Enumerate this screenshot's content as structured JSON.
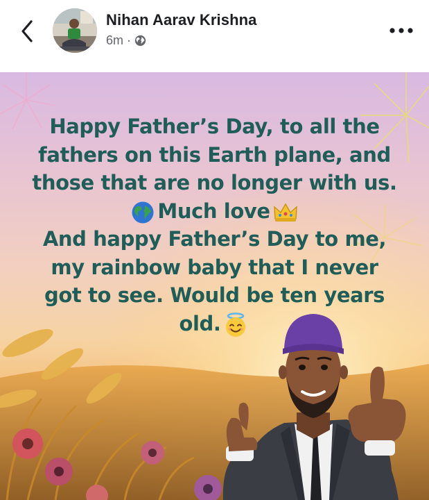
{
  "header": {
    "author_name": "Nihan Aarav Krishna",
    "timestamp": "6m",
    "separator": "·",
    "privacy_icon": "globe-icon",
    "back_icon": "chevron-left-icon",
    "more_icon": "more-horizontal-icon"
  },
  "post": {
    "lines": [
      "Happy Father’s Day, to all the",
      "fathers on this Earth plane, and",
      "those that are no longer with us.",
      "Much love",
      "And happy Father’s Day to me,",
      "my rainbow baby that I never",
      "got to see. Would be ten years",
      "old."
    ],
    "emojis": [
      "globe-emoji",
      "crown-emoji",
      "halo-smile-emoji"
    ],
    "text_color": "#1f5d58"
  },
  "colors": {
    "text_primary": "#1c1e21",
    "text_secondary": "#65676b"
  }
}
